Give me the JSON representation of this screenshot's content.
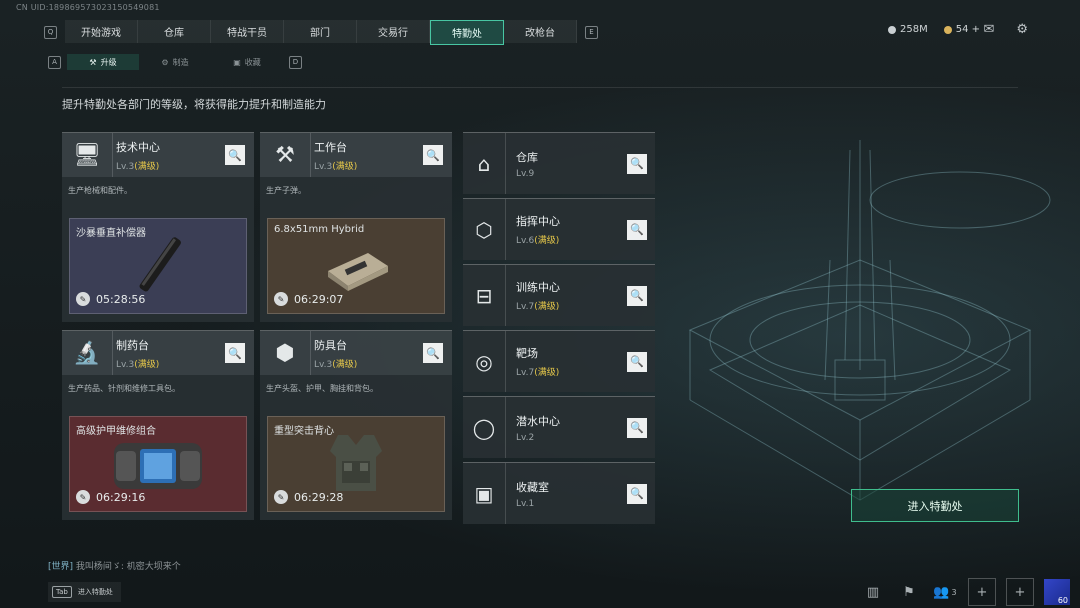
{
  "uid": "CN UID:189869573023150549081",
  "nav": {
    "key_left": "Q",
    "key_right": "E",
    "tabs": [
      "开始游戏",
      "仓库",
      "特战干员",
      "部门",
      "交易行",
      "特勤处",
      "改枪台"
    ],
    "active": "特勤处"
  },
  "resources": {
    "currency1": "258M",
    "currency2": "54 +"
  },
  "subnav": {
    "key_left": "A",
    "key_right": "D",
    "tabs": [
      "升级",
      "制造",
      "收藏"
    ],
    "active": "升级"
  },
  "description": "提升特勤处各部门的等级，将获得能力提升和制造能力",
  "cards": [
    {
      "name": "技术中心",
      "level": "Lv.3",
      "max": "(满级)",
      "desc": "生产枪械和配件。",
      "craft_item": "沙暴垂直补偿器",
      "time": "05:28:56"
    },
    {
      "name": "工作台",
      "level": "Lv.3",
      "max": "(满级)",
      "desc": "生产子弹。",
      "craft_item": "6.8x51mm Hybrid",
      "time": "06:29:07"
    },
    {
      "name": "制药台",
      "level": "Lv.3",
      "max": "(满级)",
      "desc": "生产药品、针剂和维修工具包。",
      "craft_item": "高级护甲维修组合",
      "time": "06:29:16"
    },
    {
      "name": "防具台",
      "level": "Lv.3",
      "max": "(满级)",
      "desc": "生产头盔、护甲、胸挂和背包。",
      "craft_item": "重型突击背心",
      "time": "06:29:28"
    }
  ],
  "rows": [
    {
      "name": "仓库",
      "level": "Lv.9",
      "max": ""
    },
    {
      "name": "指挥中心",
      "level": "Lv.6",
      "max": "(满级)"
    },
    {
      "name": "训练中心",
      "level": "Lv.7",
      "max": "(满级)"
    },
    {
      "name": "靶场",
      "level": "Lv.7",
      "max": "(满级)"
    },
    {
      "name": "潜水中心",
      "level": "Lv.2",
      "max": ""
    },
    {
      "name": "收藏室",
      "level": "Lv.1",
      "max": ""
    }
  ],
  "enter_button": "进入特勤处",
  "chat": {
    "channel": "[世界]",
    "message": "我叫杨间ゞ: 机密大坝来个"
  },
  "bottom": {
    "tab_key": "Tab",
    "tab_label": "进入特勤处",
    "friends": "3",
    "avatar_level": "60"
  },
  "colors": {
    "accent": "#48c6a3",
    "max_level": "#e6c84a",
    "craft_card1": "#3b3e55",
    "craft_card2": "#4a3f33",
    "craft_card3": "#5a2c30",
    "craft_card4": "#4a3f33"
  }
}
